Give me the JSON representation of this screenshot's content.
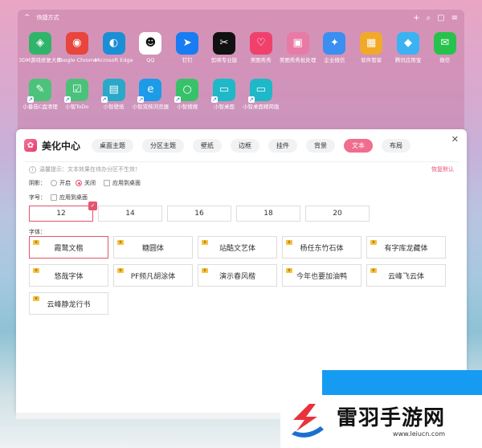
{
  "fence": {
    "title": "快捷方式",
    "icons_row1": [
      {
        "label": "3DM游戏修复大师",
        "icon": "gamepad-icon",
        "color": "#2fb56a"
      },
      {
        "label": "Google Chrome",
        "icon": "chrome-icon",
        "color": "#e8453c"
      },
      {
        "label": "Microsoft Edge",
        "icon": "edge-icon",
        "color": "#1a8fd6"
      },
      {
        "label": "QQ",
        "icon": "penguin-icon",
        "color": "#ffffff"
      },
      {
        "label": "钉钉",
        "icon": "dingtalk-icon",
        "color": "#1a7cf2"
      },
      {
        "label": "剪映专业版",
        "icon": "capcut-icon",
        "color": "#111111"
      },
      {
        "label": "美图秀秀",
        "icon": "meitu-icon",
        "color": "#f0416c"
      },
      {
        "label": "美图秀秀批处理",
        "icon": "meitu-batch-icon",
        "color": "#e87aa6"
      },
      {
        "label": "企业微信",
        "icon": "wecom-icon",
        "color": "#3a8ff0"
      },
      {
        "label": "软件管家",
        "icon": "software-manager-icon",
        "color": "#f2a92a"
      },
      {
        "label": "腾讯应用宝",
        "icon": "appstore-icon",
        "color": "#3bb3f2"
      },
      {
        "label": "微信",
        "icon": "wechat-icon",
        "color": "#27c24c"
      }
    ],
    "icons_row2": [
      {
        "label": "小番茄C盘清理",
        "icon": "broom-icon",
        "color": "#4cc37a"
      },
      {
        "label": "小智ToDo",
        "icon": "todo-icon",
        "color": "#4bc27a"
      },
      {
        "label": "小智壁纸",
        "icon": "wallpaper-icon",
        "color": "#2aa8c8"
      },
      {
        "label": "小智双核浏览器",
        "icon": "browser-icon",
        "color": "#1c9be8"
      },
      {
        "label": "小智搜搜",
        "icon": "search-ring-icon",
        "color": "#37c26a"
      },
      {
        "label": "小智桌面",
        "icon": "desktop-icon",
        "color": "#1fb8c8"
      },
      {
        "label": "小智桌面精简版",
        "icon": "desktop-lite-icon",
        "color": "#1fb8c8"
      }
    ]
  },
  "panel": {
    "title": "美化中心",
    "tabs": [
      "桌面主题",
      "分区主题",
      "壁纸",
      "边框",
      "挂件",
      "背景",
      "文本",
      "布局"
    ],
    "active_tab": "文本",
    "tip": "温馨提示：文本效果在待办分区不生效！",
    "restore": "恢复默认",
    "shadow_label": "阴影：",
    "shadow_on": "开启",
    "shadow_off": "关闭",
    "apply_desktop": "应用到桌面",
    "size_label": "字号：",
    "sizes": [
      "12",
      "14",
      "16",
      "18",
      "20"
    ],
    "font_label": "字体：",
    "fonts": [
      "霞鹜文楷",
      "糖圆体",
      "站酷文艺体",
      "杨任东竹石体",
      "有字库龙藏体",
      "悠哉字体",
      "PF频凡胡涂体",
      "演示春风楷",
      "今年也要加油鸭",
      "云峰飞云体",
      "云峰静龙行书"
    ]
  },
  "watermark": {
    "name": "雷羽手游网",
    "url": "www.leiucn.com"
  }
}
